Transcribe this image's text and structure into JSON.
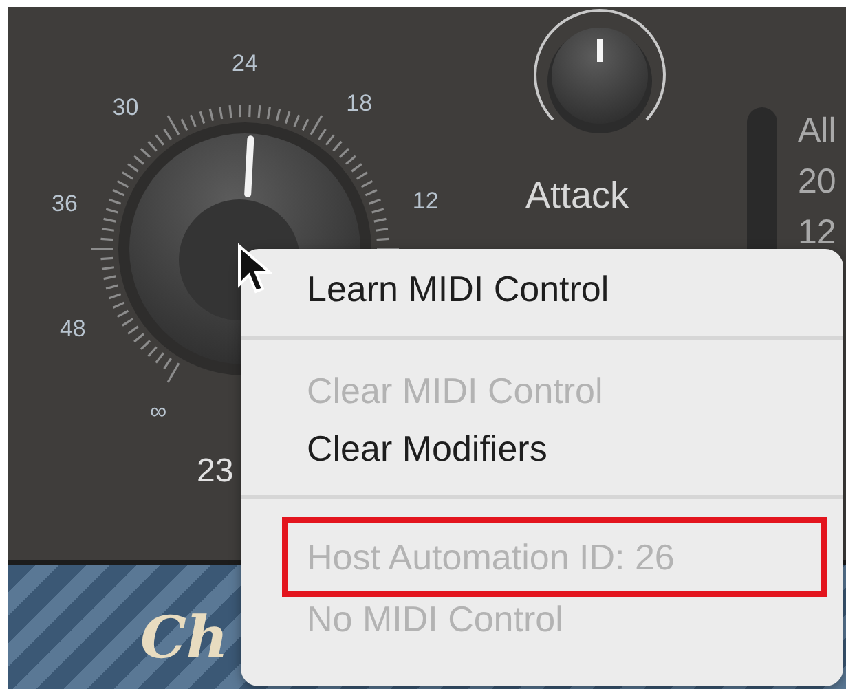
{
  "dial": {
    "scale_labels": [
      "24",
      "30",
      "18",
      "36",
      "12",
      "48",
      "∞"
    ],
    "value": "23"
  },
  "attack": {
    "label": "Attack"
  },
  "meter_labels": [
    "All",
    "20",
    "12"
  ],
  "logo": "Ch",
  "context_menu": {
    "items": [
      {
        "kind": "item",
        "label": "Learn MIDI Control",
        "disabled": false,
        "outlined": false
      },
      {
        "kind": "separator"
      },
      {
        "kind": "item",
        "label": "Clear MIDI Control",
        "disabled": true,
        "outlined": false
      },
      {
        "kind": "item",
        "label": "Clear Modifiers",
        "disabled": false,
        "outlined": false
      },
      {
        "kind": "separator"
      },
      {
        "kind": "item",
        "label": "Host Automation ID: 26",
        "disabled": true,
        "outlined": true
      },
      {
        "kind": "item",
        "label": "No MIDI Control",
        "disabled": true,
        "outlined": false
      }
    ]
  }
}
